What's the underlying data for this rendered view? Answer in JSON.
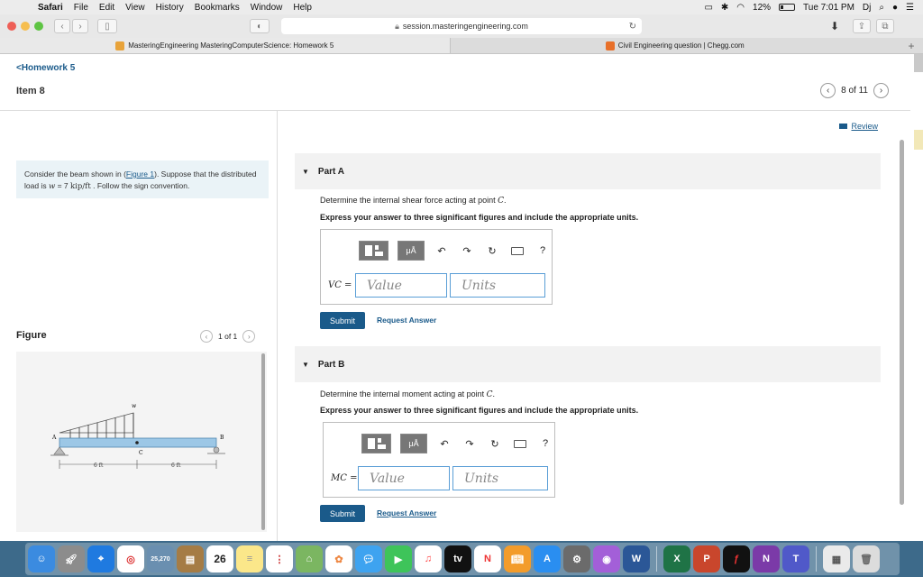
{
  "menubar": {
    "app": "Safari",
    "items": [
      "File",
      "Edit",
      "View",
      "History",
      "Bookmarks",
      "Window",
      "Help"
    ],
    "battery": "12%",
    "clock": "Tue 7:01 PM",
    "user": "Dj"
  },
  "toolbar": {
    "url": "session.masteringengineering.com"
  },
  "tabs": [
    {
      "label": "MasteringEngineering MasteringComputerScience: Homework 5"
    },
    {
      "label": "Civil Engineering question | Chegg.com"
    }
  ],
  "header": {
    "back_link": "<Homework 5",
    "item_title": "Item 8",
    "pager": "8 of 11",
    "review": "Review"
  },
  "problem": {
    "text1": "Consider the beam shown in (",
    "figure_link": "Figure 1",
    "text2": "). Suppose that the distributed load is ",
    "w_var": "w",
    "w_eq": " = 7 ",
    "w_unit": "kip/ft",
    "text3": " . Follow the sign convention."
  },
  "figure": {
    "label": "Figure",
    "pager": "1 of 1",
    "beam": {
      "load_label": "w",
      "end_a": "A",
      "end_b": "B",
      "point_c": "C",
      "dim_left": "6 ft",
      "dim_right": "6 ft"
    }
  },
  "partA": {
    "title": "Part A",
    "question": "Determine the internal shear force acting at point ",
    "point": "C",
    "instruction": "Express your answer to three significant figures and include the appropriate units.",
    "var_label": "VC =",
    "value_placeholder": "Value",
    "units_placeholder": "Units",
    "submit": "Submit",
    "request": "Request Answer"
  },
  "partB": {
    "title": "Part B",
    "question": "Determine the internal moment acting at point ",
    "point": "C",
    "instruction": "Express your answer to three significant figures and include the appropriate units.",
    "var_label": "MC =",
    "value_placeholder": "Value",
    "units_placeholder": "Units",
    "submit": "Submit",
    "request": "Request Answer"
  },
  "tools": {
    "mu": "μÅ",
    "help": "?"
  },
  "dock": {
    "calendar_day": "26",
    "badge_photos": "25,270"
  }
}
